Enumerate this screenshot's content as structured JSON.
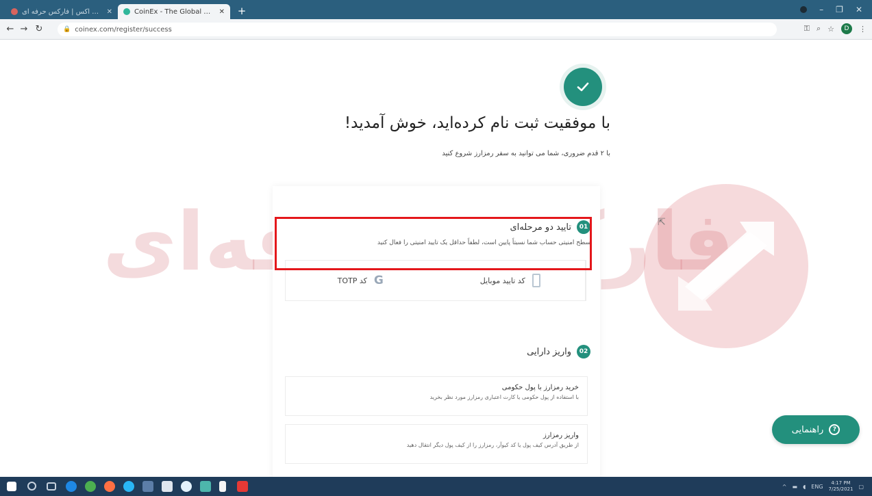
{
  "browser": {
    "tabs": [
      {
        "title": "از ثبت نام تا معامله در کوین اکس | فارکس حرفه ای",
        "active": false
      },
      {
        "title": "CoinEx - The Global Digital Coin Exchange",
        "active": true
      }
    ],
    "new_tab_symbol": "+",
    "url": "coinex.com/register/success",
    "account_initial": "D"
  },
  "page": {
    "headline": "با موفقیت ثبت نام کرده‌اید، خوش آمدید!",
    "subline": "با ۲ قدم ضروری، شما می توانید به سفر رمزارز شروع کنید",
    "steps": [
      {
        "number": "01",
        "title": "تایید دو مرحله‌ای",
        "description": "سطح امنیتی حساب شما نسبتاً پایین است، لطفاً حداقل یک تایید امنیتی را فعال کنید",
        "options": [
          {
            "label": "کد TOTP",
            "icon": "google-authenticator-icon"
          },
          {
            "label": "کد تایید موبایل",
            "icon": "mobile-phone-icon"
          }
        ]
      },
      {
        "number": "02",
        "title": "واریز دارایی",
        "options": [
          {
            "title": "خرید رمزارز با پول حکومی",
            "description": "با استفاده از پول حکومی یا کارت اعتباری رمزارز مورد نظر بخرید"
          },
          {
            "title": "واریز رمزارز",
            "description": "از طریق آدرس کیف پول یا کد کیوآر، رمزارز را از کیف پول دیگر انتقال دهید"
          }
        ]
      }
    ],
    "help_button": "راهنمایی",
    "watermark": "فارکس حرفه‌ای"
  },
  "taskbar": {
    "time": "4:17 PM",
    "date": "7/25/2021",
    "lang": "ENG"
  },
  "colors": {
    "accent": "#23907d",
    "highlight": "#e4171b",
    "tabbar": "#2b5f7e",
    "taskbar": "#1f3c5a"
  }
}
